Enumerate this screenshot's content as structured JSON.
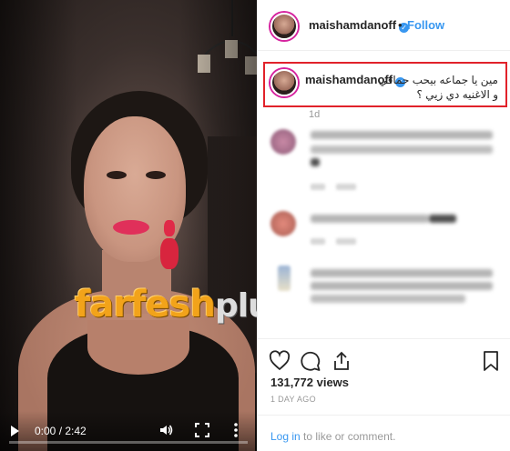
{
  "video": {
    "time": "0:00 / 2:42",
    "progress": 0,
    "watermark_main": "farfesh",
    "watermark_plus": "plus.com",
    "icons": [
      "play-icon",
      "volume-icon",
      "fullscreen-icon",
      "more-options-icon"
    ]
  },
  "header": {
    "username": "maishamdanoff",
    "separator": "•",
    "follow_label": "Follow",
    "verified_icon": "verified-badge-icon"
  },
  "caption": {
    "username": "maishamdanoff",
    "line1": "مين يا جماعه بيحب حماقي",
    "line2": "و الاغنيه دي زيي ؟",
    "age": "1d"
  },
  "actions": {
    "icons": [
      "heart-icon",
      "comment-icon",
      "share-icon",
      "bookmark-icon"
    ]
  },
  "stats": {
    "views": "131,772 views",
    "date": "1 DAY AGO"
  },
  "comment_bar": {
    "login_link": "Log in",
    "login_rest": " to like or comment."
  },
  "colors": {
    "accent": "#3897f0",
    "highlight_box": "#e1222a",
    "watermark": "#f2a31a"
  }
}
